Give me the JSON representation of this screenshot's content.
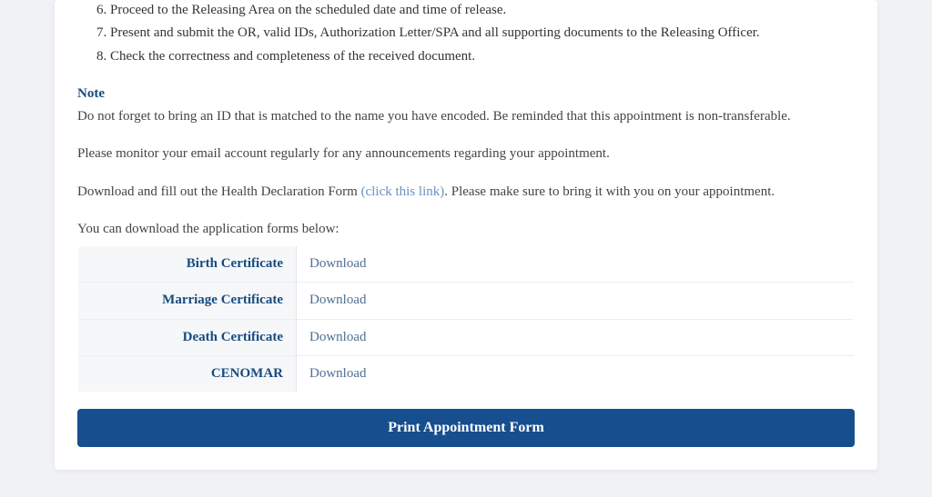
{
  "steps": [
    {
      "n": 6,
      "text": "Proceed to the Releasing Area on the scheduled date and time of release."
    },
    {
      "n": 7,
      "text": "Present and submit the OR, valid IDs, Authorization Letter/SPA and all supporting documents to the Releasing Officer."
    },
    {
      "n": 8,
      "text": "Check the correctness and completeness of the received document."
    }
  ],
  "note": {
    "heading": "Note",
    "body": "Do not forget to bring an ID that is matched to the name you have encoded. Be reminded that this appointment is non-transferable."
  },
  "monitor_text": "Please monitor your email account regularly for any announcements regarding your appointment.",
  "health_form": {
    "pre": "Download and fill out the Health Declaration Form ",
    "link": "(click this link)",
    "post": ". Please make sure to bring it with you on your appointment."
  },
  "forms_intro": "You can download the application forms below:",
  "forms": [
    {
      "label": "Birth Certificate",
      "action": "Download"
    },
    {
      "label": "Marriage Certificate",
      "action": "Download"
    },
    {
      "label": "Death Certificate",
      "action": "Download"
    },
    {
      "label": "CENOMAR",
      "action": "Download"
    }
  ],
  "print_button": "Print Appointment Form"
}
